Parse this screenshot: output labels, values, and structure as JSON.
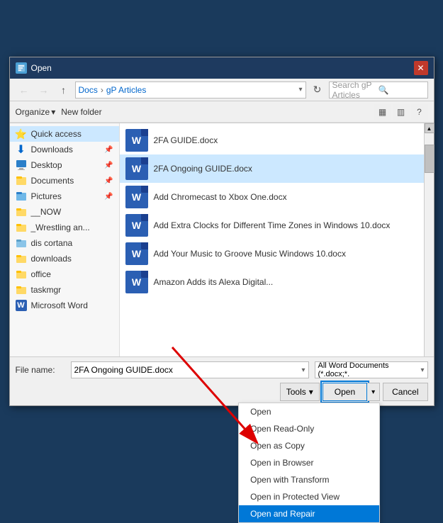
{
  "dialog": {
    "title": "Open",
    "close_label": "✕"
  },
  "toolbar": {
    "back_label": "←",
    "forward_label": "→",
    "up_label": "↑",
    "breadcrumb_folder": "Docs",
    "breadcrumb_subfolder": "gP Articles",
    "refresh_label": "↻",
    "search_placeholder": "Search gP Articles",
    "search_icon": "🔍"
  },
  "action_bar": {
    "organize_label": "Organize",
    "new_folder_label": "New folder",
    "view_icon1": "▦",
    "view_icon2": "▥",
    "view_icon3": "?"
  },
  "sidebar": {
    "items": [
      {
        "label": "Quick access",
        "icon": "⭐",
        "pinned": false,
        "active": true
      },
      {
        "label": "Downloads",
        "icon": "⬇",
        "pinned": true
      },
      {
        "label": "Desktop",
        "icon": "🖥",
        "pinned": true
      },
      {
        "label": "Documents",
        "icon": "📁",
        "pinned": true
      },
      {
        "label": "Pictures",
        "icon": "🖼",
        "pinned": true
      },
      {
        "label": "__NOW",
        "icon": "📁",
        "pinned": false
      },
      {
        "label": "_Wrestling an...",
        "icon": "📁",
        "pinned": false
      },
      {
        "label": "dis cortana",
        "icon": "📁",
        "pinned": false
      },
      {
        "label": "downloads",
        "icon": "📁",
        "pinned": false
      },
      {
        "label": "office",
        "icon": "📁",
        "pinned": false
      },
      {
        "label": "taskmgr",
        "icon": "📁",
        "pinned": false
      },
      {
        "label": "Microsoft Word",
        "icon": "W",
        "pinned": false
      }
    ]
  },
  "files": [
    {
      "name": "2FA GUIDE.docx",
      "selected": false
    },
    {
      "name": "2FA Ongoing GUIDE.docx",
      "selected": true
    },
    {
      "name": "Add Chromecast to Xbox One.docx",
      "selected": false
    },
    {
      "name": "Add Extra Clocks for Different Time Zones in Windows 10.docx",
      "selected": false
    },
    {
      "name": "Add Your Music to Groove Music Windows 10.docx",
      "selected": false
    },
    {
      "name": "Amazon Adds its Alexa Digital...",
      "selected": false
    }
  ],
  "bottom_bar": {
    "file_name_label": "File name:",
    "file_name_value": "2FA Ongoing GUIDE.docx",
    "file_type_value": "All Word Documents (*.docx;*.",
    "tools_label": "Tools",
    "open_label": "Open",
    "cancel_label": "Cancel"
  },
  "dropdown_menu": {
    "items": [
      {
        "label": "Open",
        "highlighted": false
      },
      {
        "label": "Open Read-Only",
        "highlighted": false
      },
      {
        "label": "Open as Copy",
        "highlighted": false
      },
      {
        "label": "Open in Browser",
        "highlighted": false
      },
      {
        "label": "Open with Transform",
        "highlighted": false
      },
      {
        "label": "Open in Protected View",
        "highlighted": false
      },
      {
        "label": "Open and Repair",
        "highlighted": true
      }
    ]
  },
  "colors": {
    "accent": "#0078d7",
    "word_blue": "#2b5fb3",
    "title_bg": "#1e3a5f",
    "highlight_bg": "#0078d7"
  }
}
